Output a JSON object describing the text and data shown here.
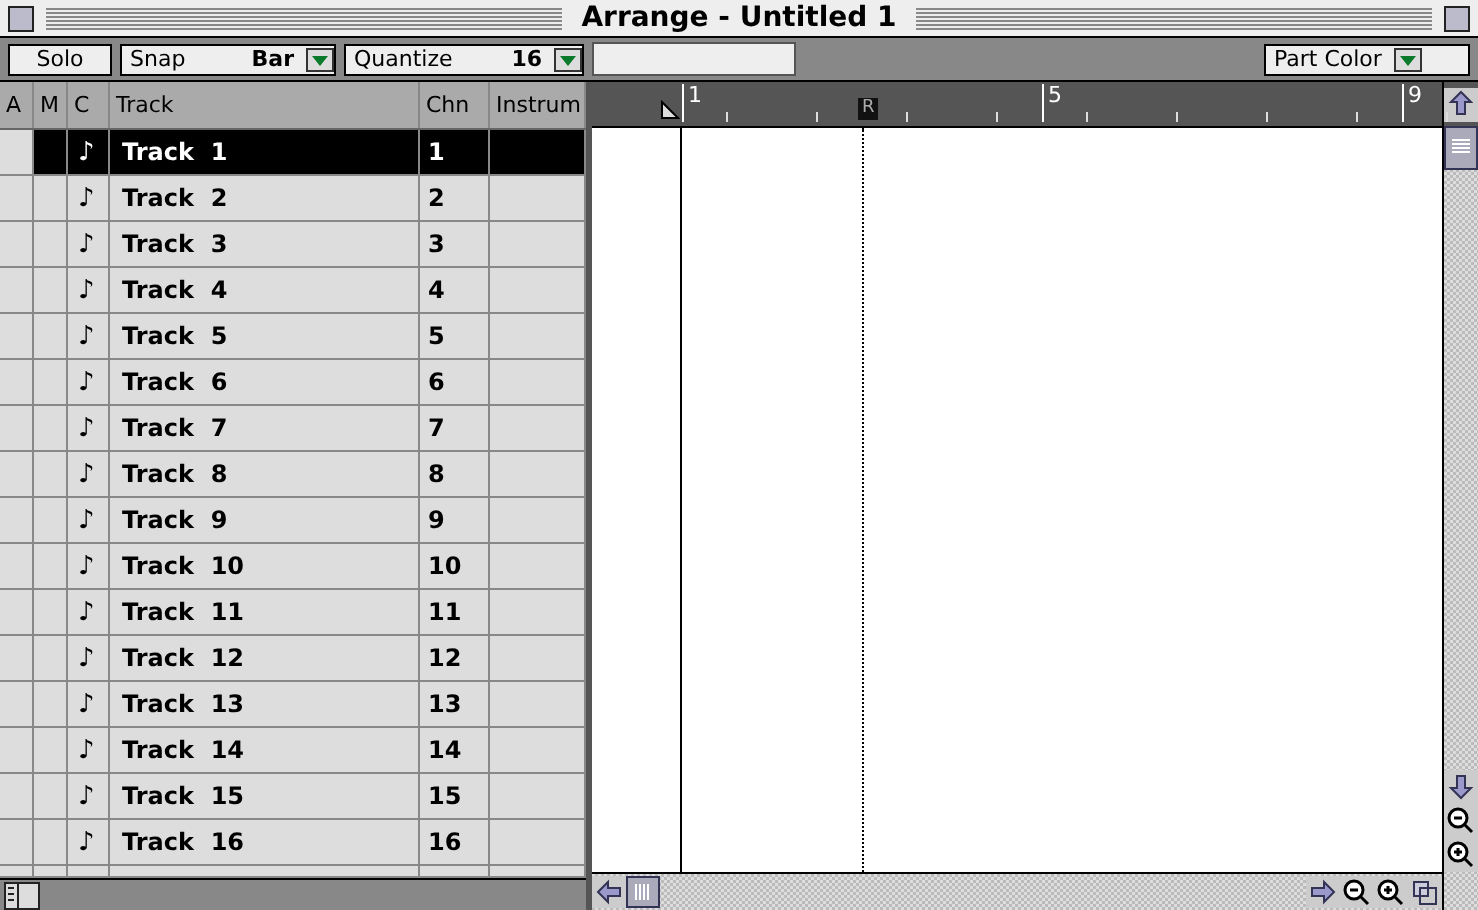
{
  "window": {
    "title": "Arrange - Untitled 1"
  },
  "toolbar": {
    "solo": "Solo",
    "snap": {
      "label": "Snap",
      "value": "Bar"
    },
    "quantize": {
      "label": "Quantize",
      "value": "16"
    },
    "view": "Part Color"
  },
  "track_list": {
    "columns": [
      "A",
      "M",
      "C",
      "Track",
      "Chn",
      "Instrum"
    ],
    "rows": [
      {
        "icon": "♪",
        "name": "Track  1",
        "channel": "1",
        "selected": true
      },
      {
        "icon": "♪",
        "name": "Track  2",
        "channel": "2",
        "selected": false
      },
      {
        "icon": "♪",
        "name": "Track  3",
        "channel": "3",
        "selected": false
      },
      {
        "icon": "♪",
        "name": "Track  4",
        "channel": "4",
        "selected": false
      },
      {
        "icon": "♪",
        "name": "Track  5",
        "channel": "5",
        "selected": false
      },
      {
        "icon": "♪",
        "name": "Track  6",
        "channel": "6",
        "selected": false
      },
      {
        "icon": "♪",
        "name": "Track  7",
        "channel": "7",
        "selected": false
      },
      {
        "icon": "♪",
        "name": "Track  8",
        "channel": "8",
        "selected": false
      },
      {
        "icon": "♪",
        "name": "Track  9",
        "channel": "9",
        "selected": false
      },
      {
        "icon": "♪",
        "name": "Track  10",
        "channel": "10",
        "selected": false
      },
      {
        "icon": "♪",
        "name": "Track  11",
        "channel": "11",
        "selected": false
      },
      {
        "icon": "♪",
        "name": "Track  12",
        "channel": "12",
        "selected": false
      },
      {
        "icon": "♪",
        "name": "Track  13",
        "channel": "13",
        "selected": false
      },
      {
        "icon": "♪",
        "name": "Track  14",
        "channel": "14",
        "selected": false
      },
      {
        "icon": "♪",
        "name": "Track  15",
        "channel": "15",
        "selected": false
      },
      {
        "icon": "♪",
        "name": "Track  16",
        "channel": "16",
        "selected": false
      }
    ]
  },
  "ruler": {
    "bars": [
      "1",
      "5",
      "9"
    ],
    "right_locator": "R"
  }
}
